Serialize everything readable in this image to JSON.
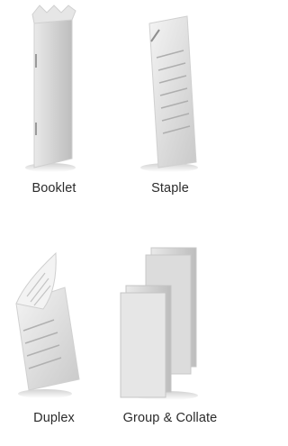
{
  "options": [
    {
      "id": "booklet",
      "label": "Booklet",
      "icon": "booklet-icon"
    },
    {
      "id": "staple",
      "label": "Staple",
      "icon": "staple-icon"
    },
    {
      "id": "duplex",
      "label": "Duplex",
      "icon": "duplex-icon"
    },
    {
      "id": "group",
      "label": "Group & Collate",
      "icon": "group-collate-icon"
    }
  ]
}
